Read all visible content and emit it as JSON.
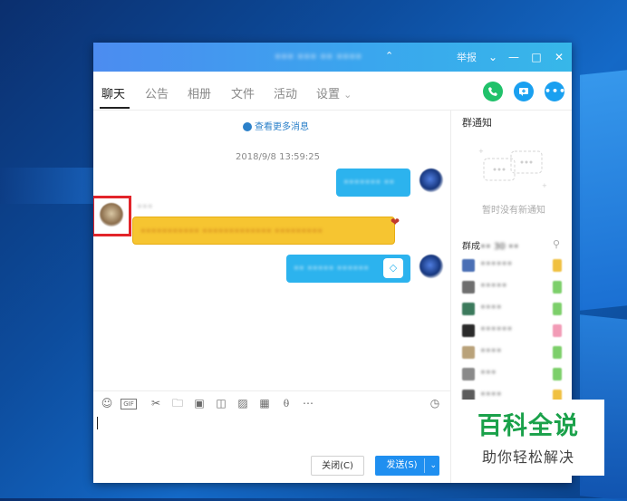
{
  "window": {
    "title": "••• ••• •• ••••",
    "report_label": "举报",
    "controls": [
      "chevron-down",
      "minimize",
      "maximize",
      "close"
    ]
  },
  "tabs": [
    {
      "label": "聊天",
      "active": true
    },
    {
      "label": "公告",
      "active": false
    },
    {
      "label": "相册",
      "active": false
    },
    {
      "label": "文件",
      "active": false
    },
    {
      "label": "活动",
      "active": false
    },
    {
      "label": "设置",
      "active": false
    }
  ],
  "action_buttons": [
    {
      "icon": "phone-icon",
      "color": "#20c16a"
    },
    {
      "icon": "screen-share-icon",
      "color": "#1aa0f0"
    },
    {
      "icon": "more-icon",
      "color": "#1aa0f0"
    }
  ],
  "chat": {
    "more_messages": "查看更多消息",
    "timestamp": "2018/9/8 13:59:25",
    "messages": [
      {
        "side": "right",
        "text": "••••••• ••"
      },
      {
        "side": "left",
        "sender": "•••",
        "text": "••••••••••• ••••••••••••• •••••••••"
      },
      {
        "side": "right",
        "text": "•• ••••• ••••••"
      }
    ]
  },
  "sidebar": {
    "notice_title": "群通知",
    "notice_empty": "暂时没有新通知",
    "members_title_prefix": "群成",
    "members_title_blurred": "•• 30 ••",
    "members": [
      {
        "name": "••••••",
        "avatar_color": "#4a6fb5",
        "tag_color": "#f0c040"
      },
      {
        "name": "•••••",
        "avatar_color": "#6f6f6f",
        "tag_color": "#7ccf6a"
      },
      {
        "name": "••••",
        "avatar_color": "#3c7a5c",
        "tag_color": "#7ccf6a"
      },
      {
        "name": "••••••",
        "avatar_color": "#2b2b2b",
        "tag_color": "#f29bb6"
      },
      {
        "name": "••••",
        "avatar_color": "#b9a27a",
        "tag_color": "#7ccf6a"
      },
      {
        "name": "•••",
        "avatar_color": "#8a8a8a",
        "tag_color": "#7ccf6a"
      },
      {
        "name": "••••",
        "avatar_color": "#5c5c5c",
        "tag_color": "#f0c040"
      }
    ]
  },
  "toolbar": {
    "tools": [
      "emoji-icon",
      "gif-icon",
      "scissors-icon",
      "folder-icon",
      "image-icon",
      "gift-box-icon",
      "gift-icon",
      "red-packet-icon",
      "bell-icon",
      "more-circle-icon"
    ],
    "history_icon": "clock-icon"
  },
  "input": {
    "close_label": "关闭(C)",
    "send_label": "发送(S)"
  },
  "watermark": {
    "main": "百科全说",
    "sub": "助你轻松解决"
  }
}
